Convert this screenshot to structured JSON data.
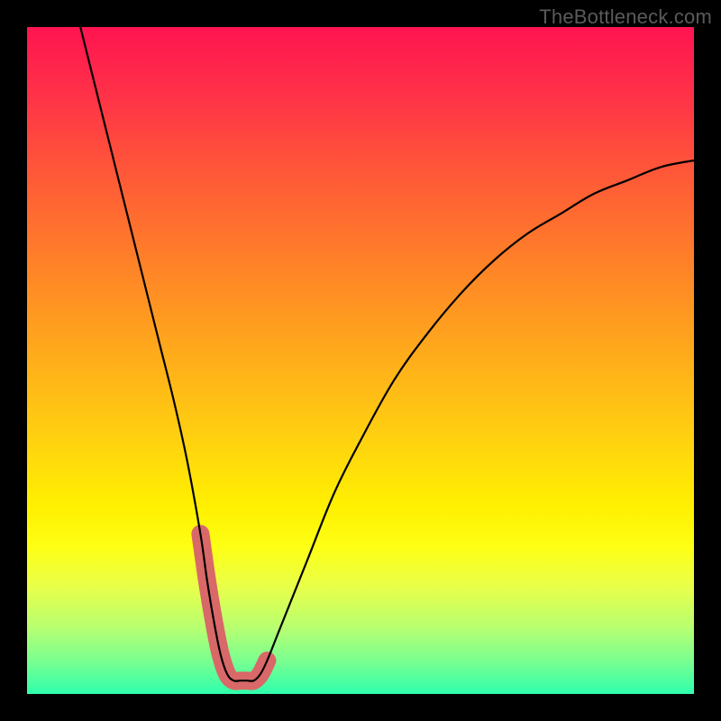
{
  "watermark": "TheBottleneck.com",
  "chart_data": {
    "type": "line",
    "title": "",
    "xlabel": "",
    "ylabel": "",
    "xlim": [
      0,
      100
    ],
    "ylim": [
      0,
      100
    ],
    "x": [
      8,
      10,
      12,
      14,
      16,
      18,
      20,
      22,
      24,
      26,
      27,
      28,
      29,
      30,
      31,
      32,
      33,
      34,
      35,
      36,
      38,
      42,
      46,
      50,
      55,
      60,
      65,
      70,
      75,
      80,
      85,
      90,
      95,
      100
    ],
    "values": [
      100,
      92,
      84,
      76,
      68,
      60,
      52,
      44,
      35,
      24,
      17,
      11,
      6,
      3,
      2,
      2,
      2,
      2,
      3,
      5,
      10,
      20,
      30,
      38,
      47,
      54,
      60,
      65,
      69,
      72,
      75,
      77,
      79,
      80
    ],
    "annotations": [
      {
        "type": "highlight-band",
        "x_start": 26,
        "x_end": 37,
        "color": "#d96868"
      }
    ]
  }
}
